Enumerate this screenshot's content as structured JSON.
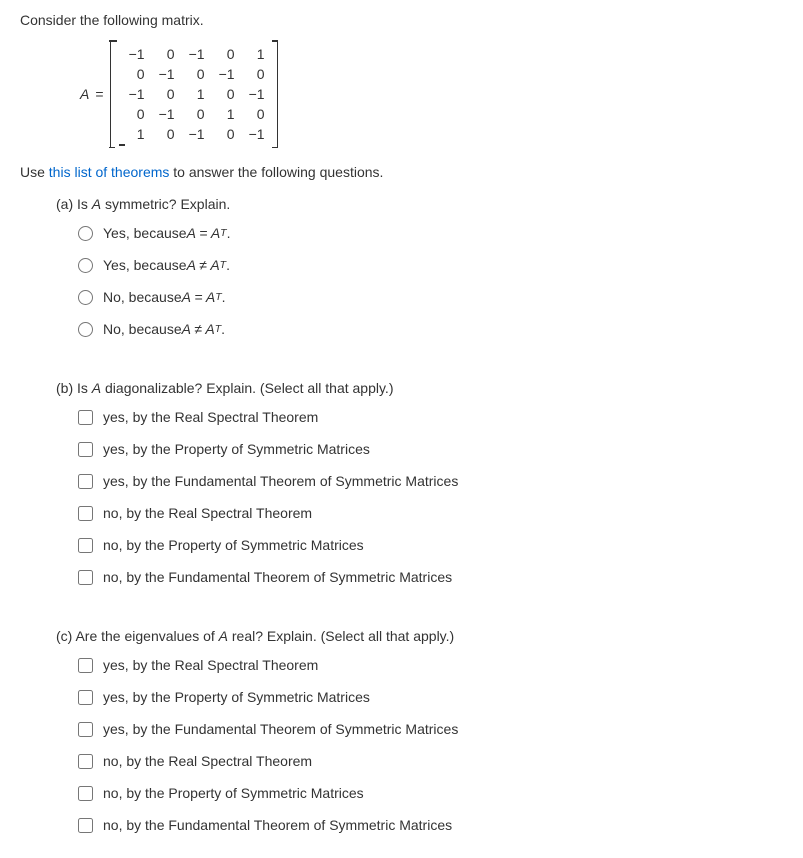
{
  "intro": "Consider the following matrix.",
  "matrixLabel": "A",
  "matrixEq": "=",
  "matrix": [
    [
      "−1",
      "0",
      "−1",
      "0",
      "1"
    ],
    [
      "0",
      "−1",
      "0",
      "−1",
      "0"
    ],
    [
      "−1",
      "0",
      "1",
      "0",
      "−1"
    ],
    [
      "0",
      "−1",
      "0",
      "1",
      "0"
    ],
    [
      "1",
      "0",
      "−1",
      "0",
      "−1"
    ]
  ],
  "instructionPrefix": "Use ",
  "instructionLink": "this list of theorems",
  "instructionSuffix": " to answer the following questions.",
  "partA": {
    "label": "(a) Is ",
    "var": "A",
    "suffix": " symmetric? Explain.",
    "options": [
      {
        "prefix": "Yes, because ",
        "expr": "A = A",
        "super": "T",
        "suffix": "."
      },
      {
        "prefix": "Yes, because ",
        "expr": "A ≠ A",
        "super": "T",
        "suffix": "."
      },
      {
        "prefix": "No, because ",
        "expr": "A = A",
        "super": "T",
        "suffix": "."
      },
      {
        "prefix": "No, because ",
        "expr": "A ≠ A",
        "super": "T",
        "suffix": "."
      }
    ]
  },
  "partB": {
    "label": "(b) Is ",
    "var": "A",
    "suffix": " diagonalizable? Explain. (Select all that apply.)",
    "options": [
      "yes, by the Real Spectral Theorem",
      "yes, by the Property of Symmetric Matrices",
      "yes, by the Fundamental Theorem of Symmetric Matrices",
      "no, by the Real Spectral Theorem",
      "no, by the Property of Symmetric Matrices",
      "no, by the Fundamental Theorem of Symmetric Matrices"
    ]
  },
  "partC": {
    "label": "(c) Are the eigenvalues of ",
    "var": "A",
    "suffix": " real? Explain. (Select all that apply.)",
    "options": [
      "yes, by the Real Spectral Theorem",
      "yes, by the Property of Symmetric Matrices",
      "yes, by the Fundamental Theorem of Symmetric Matrices",
      "no, by the Real Spectral Theorem",
      "no, by the Property of Symmetric Matrices",
      "no, by the Fundamental Theorem of Symmetric Matrices"
    ]
  }
}
